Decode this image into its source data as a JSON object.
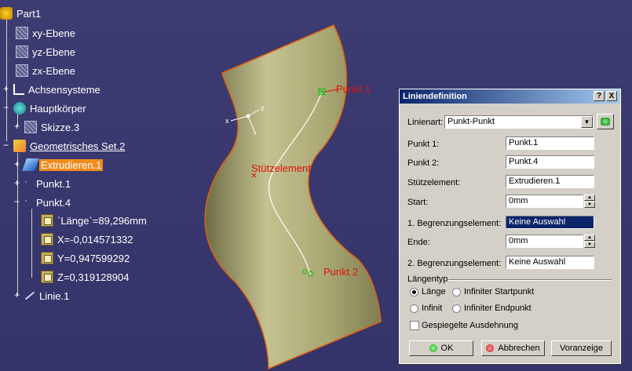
{
  "tree": {
    "items": [
      {
        "label": "Part1",
        "icon": "part-icon"
      },
      {
        "label": "xy-Ebene",
        "icon": "plane-icon"
      },
      {
        "label": "yz-Ebene",
        "icon": "plane-icon"
      },
      {
        "label": "zx-Ebene",
        "icon": "plane-icon"
      },
      {
        "label": "Achsensysteme",
        "icon": "axis-system-icon"
      },
      {
        "label": "Hauptkörper",
        "icon": "body-icon"
      },
      {
        "label": "Skizze.3",
        "icon": "sketch-icon"
      },
      {
        "label": "Geometrisches Set.2",
        "icon": "geometric-set-icon"
      },
      {
        "label": "Extrudieren.1",
        "icon": "extrude-icon"
      },
      {
        "label": "Punkt.1",
        "icon": "point-icon"
      },
      {
        "label": "Punkt.4",
        "icon": "point-icon"
      },
      {
        "label": "`Länge`=89,296mm",
        "icon": "parameter-icon"
      },
      {
        "label": "X=-0,014571332",
        "icon": "parameter-icon"
      },
      {
        "label": "Y=0,947599292",
        "icon": "parameter-icon"
      },
      {
        "label": "Z=0,319128904",
        "icon": "parameter-icon"
      },
      {
        "label": "Linie.1",
        "icon": "line-icon"
      }
    ]
  },
  "viewport": {
    "labels": {
      "punkt1": "Punkt 1",
      "punkt2": "Punkt 2",
      "stuetz": "Stützelement"
    },
    "surface_color": "#b8b67e",
    "label_color": "#e01010"
  },
  "dialog": {
    "title": "Liniendefinition",
    "help": "?",
    "close": "X",
    "linienart_label": "Linienart:",
    "linienart_value": "Punkt-Punkt",
    "punkt1_label": "Punkt 1:",
    "punkt1_value": "Punkt.1",
    "punkt2_label": "Punkt 2:",
    "punkt2_value": "Punkt.4",
    "stuetz_label": "Stützelement:",
    "stuetz_value": "Extrudieren.1",
    "start_label": "Start:",
    "start_value": "0mm",
    "begr1_label": "1. Begrenzungselement:",
    "begr1_value": "Keine Auswahl",
    "ende_label": "Ende:",
    "ende_value": "0mm",
    "begr2_label": "2. Begrenzungselement:",
    "begr2_value": "Keine Auswahl",
    "laengentyp_label": "Längentyp",
    "radio_laenge": "Länge",
    "radio_inf_start": "Infiniter Startpunkt",
    "radio_infinit": "Infinit",
    "radio_inf_end": "Infiniter Endpunkt",
    "gespiegelt": "Gespiegelte Ausdehnung",
    "ok": "OK",
    "abbrechen": "Abbrechen",
    "voranzeige": "Voranzeige"
  }
}
